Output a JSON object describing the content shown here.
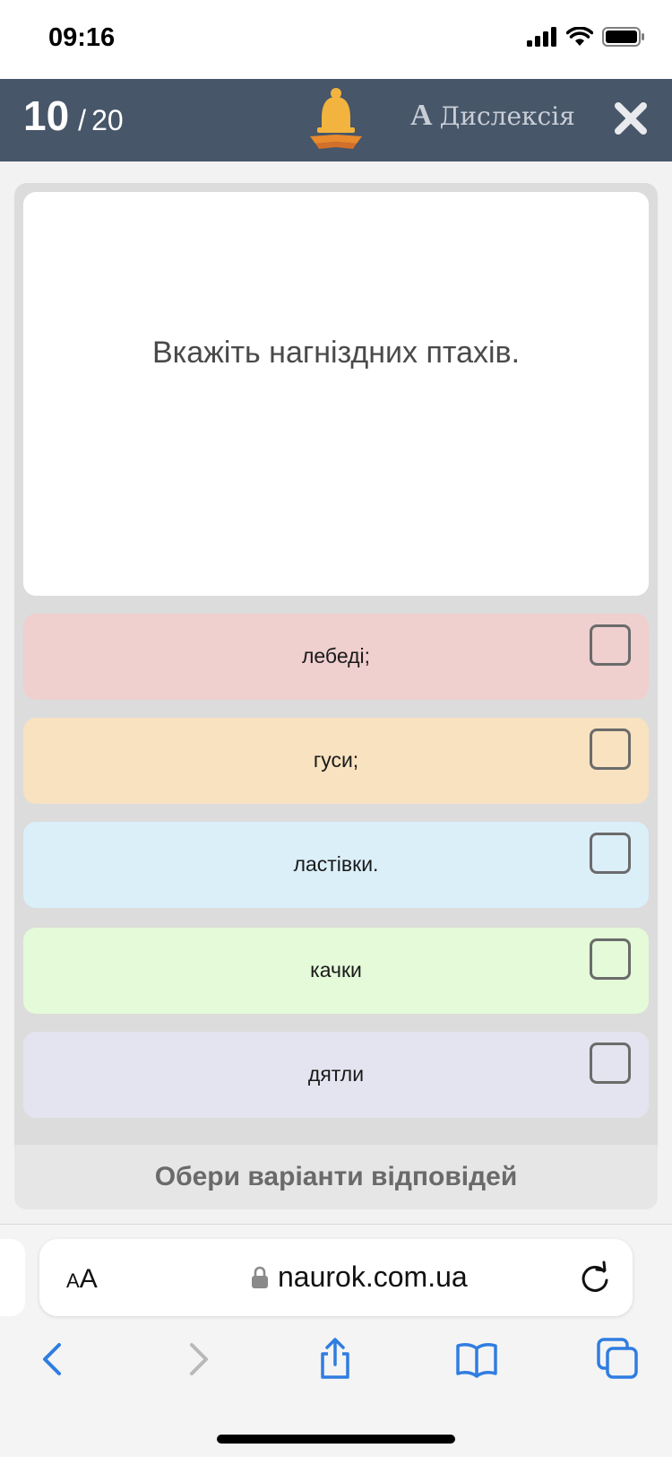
{
  "status_bar": {
    "time": "09:16"
  },
  "header": {
    "current_question": "10",
    "separator": "/",
    "total_questions": "20",
    "dyslexia_letter": "A",
    "dyslexia_label": "Дислексія",
    "logo_icon": "bell-book-icon",
    "close_icon": "close-icon"
  },
  "question": {
    "text": "Вкажіть нагніздних птахів."
  },
  "options": [
    {
      "label": "лебеді;",
      "color": "#f0cfcf"
    },
    {
      "label": "гуси;",
      "color": "#f8e2c0"
    },
    {
      "label": "ластівки.",
      "color": "#dbeff9"
    },
    {
      "label": "качки",
      "color": "#e4fad8"
    },
    {
      "label": "дятли",
      "color": "#e3e4ef"
    }
  ],
  "submit": {
    "label": "Обери варіанти відповідей"
  },
  "browser": {
    "aa_small": "A",
    "aa_large": "A",
    "url": "naurok.com.ua",
    "accent_color": "#2f7de1"
  }
}
